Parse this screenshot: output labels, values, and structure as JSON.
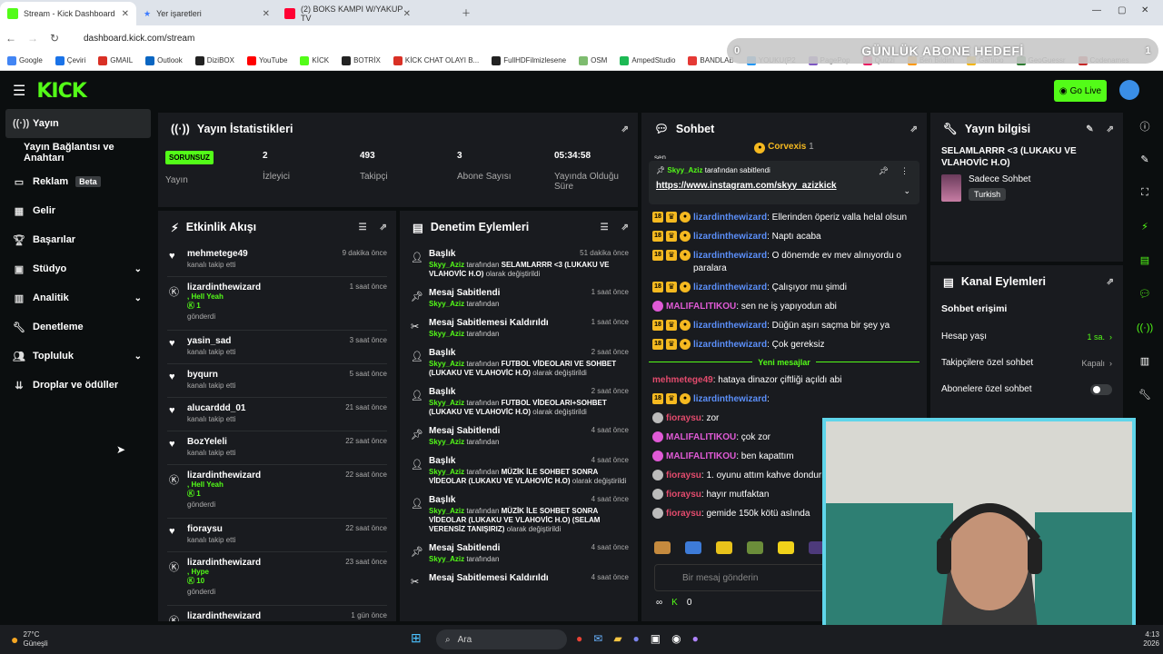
{
  "browser": {
    "tabs": [
      {
        "title": "Stream - Kick Dashboard",
        "color": "#53fc18"
      },
      {
        "title": "Yer işaretleri",
        "color": "#3d7bff"
      },
      {
        "title": "(2) BOKS KAMPI W/YAKUP TV",
        "color": "#ff0033"
      }
    ],
    "url": "dashboard.kick.com/stream",
    "bookmarks": [
      "Google",
      "Çeviri",
      "GMAIL",
      "Outlook",
      "DiziBOX",
      "YouTube",
      "KİCK",
      "BOTRİX",
      "KİCK CHAT OLAYI B...",
      "FullHDFilmizlesene",
      "OSM",
      "AmpedStudio",
      "BANDLAB",
      "YOUKU(P2",
      "PagePop",
      "Quizzi",
      "Ben Bildim",
      "Garticio",
      "GeoGuessr",
      "Codenames"
    ],
    "overlay": {
      "title": "GÜNLÜK ABONE HEDEFİ",
      "left": "0",
      "right": "1"
    }
  },
  "header": {
    "logo": "KICK",
    "go_live": "Go Live"
  },
  "sidebar": [
    {
      "label": "Yayın",
      "icon": "broadcast-icon"
    },
    {
      "label": "Yayın Bağlantısı ve Anahtarı",
      "icon": ""
    },
    {
      "label": "Reklam",
      "icon": "ad-icon",
      "badge": "Beta"
    },
    {
      "label": "Gelir",
      "icon": "revenue-icon"
    },
    {
      "label": "Başarılar",
      "icon": "trophy-icon"
    },
    {
      "label": "Stüdyo",
      "icon": "studio-icon"
    },
    {
      "label": "Analitik",
      "icon": "analytics-icon"
    },
    {
      "label": "Denetleme",
      "icon": "wrench-icon"
    },
    {
      "label": "Topluluk",
      "icon": "community-icon"
    },
    {
      "label": "Droplar ve ödüller",
      "icon": "drops-icon"
    }
  ],
  "stats": {
    "title": "Yayın İstatistikleri",
    "status_badge": "SORUNSUZ",
    "status_label": "Yayın",
    "viewers": "2",
    "viewers_label": "İzleyici",
    "followers": "493",
    "followers_label": "Takipçi",
    "subs": "3",
    "subs_label": "Abone Sayısı",
    "uptime": "05:34:58",
    "uptime_label": "Yayında Olduğu Süre"
  },
  "activity": {
    "title": "Etkinlik Akışı",
    "events": [
      {
        "name": "mehmetege49",
        "sub": "kanalı takip etti",
        "time": "9 dakika önce",
        "type": "follow"
      },
      {
        "name": "lizardinthewizard",
        "gift": ", Hell Yeah",
        "count": "1",
        "sub": "gönderdi",
        "time": "1 saat önce",
        "type": "gift"
      },
      {
        "name": "yasin_sad",
        "sub": "kanalı takip etti",
        "time": "3 saat önce",
        "type": "follow"
      },
      {
        "name": "byqurn",
        "sub": "kanalı takip etti",
        "time": "5 saat önce",
        "type": "follow"
      },
      {
        "name": "alucarddd_01",
        "sub": "kanalı takip etti",
        "time": "21 saat önce",
        "type": "follow"
      },
      {
        "name": "BozYeleli",
        "sub": "kanalı takip etti",
        "time": "22 saat önce",
        "type": "follow"
      },
      {
        "name": "lizardinthewizard",
        "gift": ", Hell Yeah",
        "count": "1",
        "sub": "gönderdi",
        "time": "22 saat önce",
        "type": "gift"
      },
      {
        "name": "fioraysu",
        "sub": "kanalı takip etti",
        "time": "22 saat önce",
        "type": "follow"
      },
      {
        "name": "lizardinthewizard",
        "gift": ", Hype",
        "count": "10",
        "sub": "gönderdi",
        "time": "23 saat önce",
        "type": "gift"
      },
      {
        "name": "lizardinthewizard",
        "sub": "",
        "time": "1 gün önce",
        "type": "gift"
      }
    ]
  },
  "moderation": {
    "title": "Denetim Eylemleri",
    "actions": [
      {
        "title": "Başlık",
        "time": "51 dakika önce",
        "user": "Skyy_Aziz",
        "pre": " tarafından ",
        "value": "SELAMLARRR <3 (LUKAKU VE VLAHOVİC H.O)",
        "post": " olarak değiştirildi",
        "icon": "person-edit-icon"
      },
      {
        "title": "Mesaj Sabitlendi",
        "time": "1 saat önce",
        "user": "Skyy_Aziz",
        "pre": " tarafından",
        "value": "",
        "post": "",
        "icon": "pin-icon"
      },
      {
        "title": "Mesaj Sabitlemesi Kaldırıldı",
        "time": "1 saat önce",
        "user": "Skyy_Aziz",
        "pre": " tarafından",
        "value": "",
        "post": "",
        "icon": "unpin-icon"
      },
      {
        "title": "Başlık",
        "time": "2 saat önce",
        "user": "Skyy_Aziz",
        "pre": " tarafından ",
        "value": "FUTBOL VİDEOLARI VE SOHBET (LUKAKU VE VLAHOVİC H.O)",
        "post": " olarak değiştirildi",
        "icon": "person-edit-icon"
      },
      {
        "title": "Başlık",
        "time": "2 saat önce",
        "user": "Skyy_Aziz",
        "pre": " tarafından ",
        "value": "FUTBOL VİDEOLARI+SOHBET (LUKAKU VE VLAHOVİC H.O)",
        "post": " olarak değiştirildi",
        "icon": "person-edit-icon"
      },
      {
        "title": "Mesaj Sabitlendi",
        "time": "4 saat önce",
        "user": "Skyy_Aziz",
        "pre": " tarafından",
        "value": "",
        "post": "",
        "icon": "pin-icon"
      },
      {
        "title": "Başlık",
        "time": "4 saat önce",
        "user": "Skyy_Aziz",
        "pre": " tarafından ",
        "value": "MÜZİK İLE SOHBET SONRA VİDEOLAR (LUKAKU VE VLAHOVİC H.O)",
        "post": " olarak değiştirildi",
        "icon": "person-edit-icon"
      },
      {
        "title": "Başlık",
        "time": "4 saat önce",
        "user": "Skyy_Aziz",
        "pre": " tarafından ",
        "value": "MÜZİK İLE SOHBET SONRA VİDEOLAR (LUKAKU VE VLAHOVİC H.O) (SELAM VERENSİZ TANIŞIRIZ)",
        "post": " olarak değiştirildi",
        "icon": "person-edit-icon"
      },
      {
        "title": "Mesaj Sabitlendi",
        "time": "4 saat önce",
        "user": "Skyy_Aziz",
        "pre": " tarafından",
        "value": "",
        "post": "",
        "icon": "pin-icon"
      },
      {
        "title": "Mesaj Sabitlemesi Kaldırıldı",
        "time": "4 saat önce",
        "user": "",
        "pre": "",
        "value": "",
        "post": "",
        "icon": "unpin-icon"
      }
    ]
  },
  "chat": {
    "title": "Sohbet",
    "top_user": "Corvexis",
    "top_count": "1",
    "pinned_by": "Skyy_Aziz",
    "pinned_suffix": " tarafından sabitlendi",
    "pinned_link": "https://www.instagram.com/skyy_azizkick",
    "cut_text": "sen",
    "messages": [
      {
        "user": "lizardinthewizard",
        "text": ": Ellerinden öperiz valla helal olsun",
        "badges": "sub",
        "cls": "u-blue"
      },
      {
        "user": "lizardinthewizard",
        "text": ": Naptı acaba",
        "badges": "sub",
        "cls": "u-blue"
      },
      {
        "user": "lizardinthewizard",
        "text": ": O dönemde ev mev alınıyordu o paralara",
        "badges": "sub",
        "cls": "u-blue"
      },
      {
        "user": "lizardinthewizard",
        "text": ": Çalışıyor mu şimdi",
        "badges": "sub",
        "cls": "u-blue"
      },
      {
        "user": "MALIFALITIKOU",
        "text": ": sen ne iş yapıyodun abi",
        "badges": "pink",
        "cls": "u-pink"
      },
      {
        "user": "lizardinthewizard",
        "text": ": Düğün aşırı saçma bir şey ya",
        "badges": "sub",
        "cls": "u-blue"
      },
      {
        "user": "lizardinthewizard",
        "text": ": Çok gereksiz",
        "badges": "sub",
        "cls": "u-blue"
      }
    ],
    "new_messages": "Yeni mesajlar",
    "messages2": [
      {
        "user": "mehmetege49",
        "text": ": hataya dinazor çiftliği açıldı abi",
        "badges": "",
        "cls": "u-red"
      },
      {
        "user": "lizardinthewizard",
        "text": ":",
        "badges": "sub",
        "cls": "u-blue"
      },
      {
        "user": "fioraysu",
        "text": ": zor",
        "badges": "gray",
        "cls": "u-red"
      },
      {
        "user": "MALIFALITIKOU",
        "text": ": çok zor",
        "badges": "pink",
        "cls": "u-pink"
      },
      {
        "user": "MALIFALITIKOU",
        "text": ": ben kapattım",
        "badges": "pink",
        "cls": "u-pink"
      },
      {
        "user": "fioraysu",
        "text": ": 1. oyunu attım kahve dondurr",
        "badges": "gray",
        "cls": "u-red"
      },
      {
        "user": "fioraysu",
        "text": ": hayır mutfaktan",
        "badges": "gray",
        "cls": "u-red"
      },
      {
        "user": "fioraysu",
        "text": ": gemide 150k kötü aslında",
        "badges": "gray",
        "cls": "u-red"
      }
    ],
    "input_placeholder": "Bir mesaj gönderin",
    "points": "0",
    "infinity": "∞",
    "badge_18": "18"
  },
  "info": {
    "title": "Yayın bilgisi",
    "stream_title": "SELAMLARRR <3 (LUKAKU VE VLAHOVİC H.O)",
    "category": "Sadece Sohbet",
    "tag": "Turkish"
  },
  "channel": {
    "title": "Kanal Eylemleri",
    "section": "Sohbet erişimi",
    "rows": [
      {
        "label": "Hesap yaşı",
        "value": "1 sa.",
        "accent": true
      },
      {
        "label": "Takipçilere özel sohbet",
        "value": "Kapalı",
        "accent": false
      },
      {
        "label": "Abonelere özel sohbet",
        "value": "",
        "toggle": true
      }
    ]
  },
  "taskbar": {
    "temp": "27°C",
    "weather": "Güneşli",
    "search": "Ara",
    "time": "4:13",
    "date": "2026"
  }
}
